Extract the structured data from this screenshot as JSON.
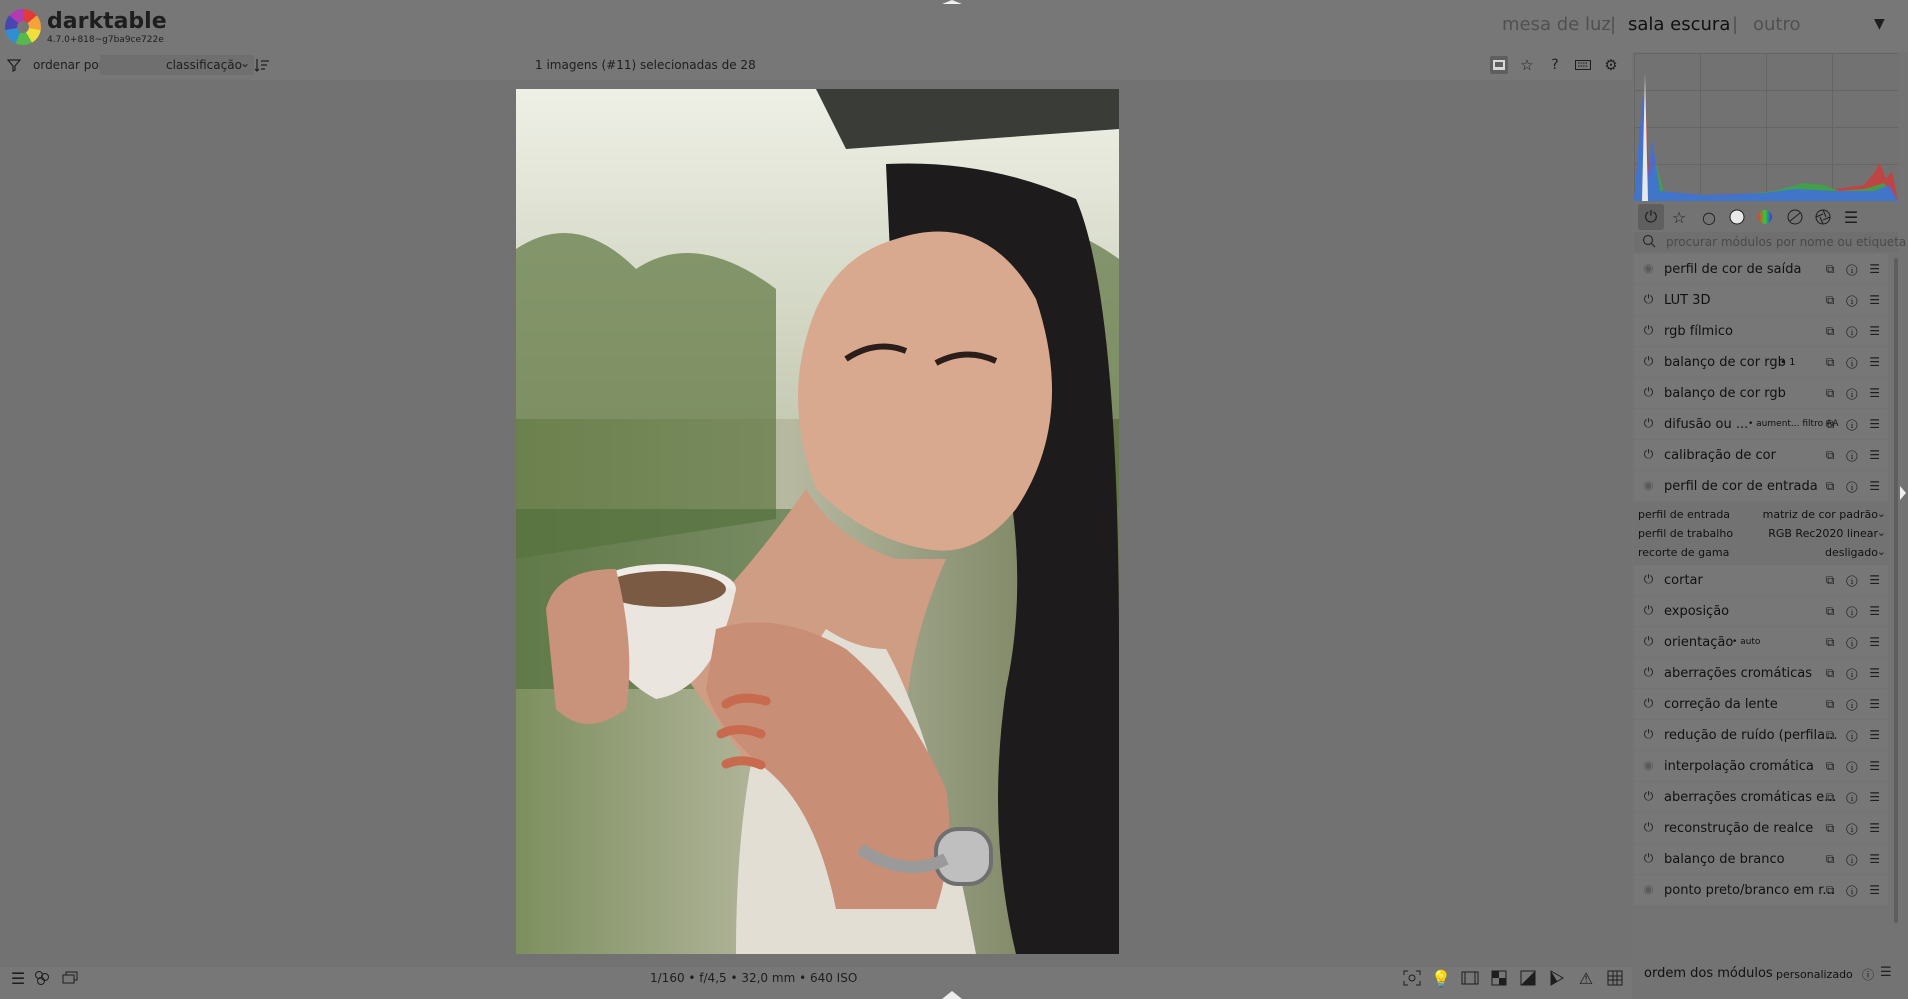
{
  "app": {
    "name": "darktable",
    "version": "4.7.0+818~g7ba9ce722e"
  },
  "views": {
    "lighttable": "mesa de luz",
    "darkroom": "sala escura",
    "other": "outro",
    "separator": "|"
  },
  "filterbar": {
    "sort_label": "ordenar por",
    "sort_value": "classificação",
    "selection_info": "1 imagens (#11) selecionadas de 28"
  },
  "image": {
    "exif": "1/160 • f/4,5 • 32,0 mm • 640 ISO"
  },
  "module_search": {
    "placeholder": "procurar módulos por nome ou etiqueta"
  },
  "modules": [
    {
      "label": "perfil de cor de saída",
      "enabled": false
    },
    {
      "label": "LUT 3D",
      "enabled": true
    },
    {
      "label": "rgb fílmico",
      "enabled": true
    },
    {
      "label": "balanço de cor rgb",
      "tag": "• 1",
      "enabled": true
    },
    {
      "label": "balanço de cor rgb",
      "enabled": true
    },
    {
      "label": "difusão ou ...",
      "tag": "• aument... filtro AA",
      "enabled": true
    },
    {
      "label": "calibração de cor",
      "enabled": true
    },
    {
      "label": "perfil de cor de entrada",
      "enabled": false
    },
    {
      "label": "cortar",
      "enabled": true
    },
    {
      "label": "exposição",
      "enabled": true
    },
    {
      "label": "orientação",
      "tag": "• auto",
      "enabled": true
    },
    {
      "label": "aberrações cromáticas",
      "enabled": true
    },
    {
      "label": "correção da lente",
      "enabled": true
    },
    {
      "label": "redução de ruído (perfila...",
      "enabled": true
    },
    {
      "label": "interpolação cromática",
      "enabled": false
    },
    {
      "label": "aberrações cromáticas e...",
      "enabled": true
    },
    {
      "label": "reconstrução de realce",
      "enabled": true
    },
    {
      "label": "balanço de branco",
      "enabled": true
    },
    {
      "label": "ponto preto/branco em r...",
      "enabled": false
    }
  ],
  "input_profile": {
    "params": [
      {
        "label": "perfil de entrada",
        "value": "matriz de cor padrão"
      },
      {
        "label": "perfil de trabalho",
        "value": "RGB Rec2020 linear"
      },
      {
        "label": "recorte de gama",
        "value": "desligado"
      }
    ]
  },
  "footer": {
    "module_order_label": "ordem dos módulos",
    "module_order_value": "personalizado"
  },
  "icons": {
    "power": "⏻",
    "off": "◉",
    "module_actions": "⧉ ⓘ ☰",
    "dropdown": "⌄"
  }
}
